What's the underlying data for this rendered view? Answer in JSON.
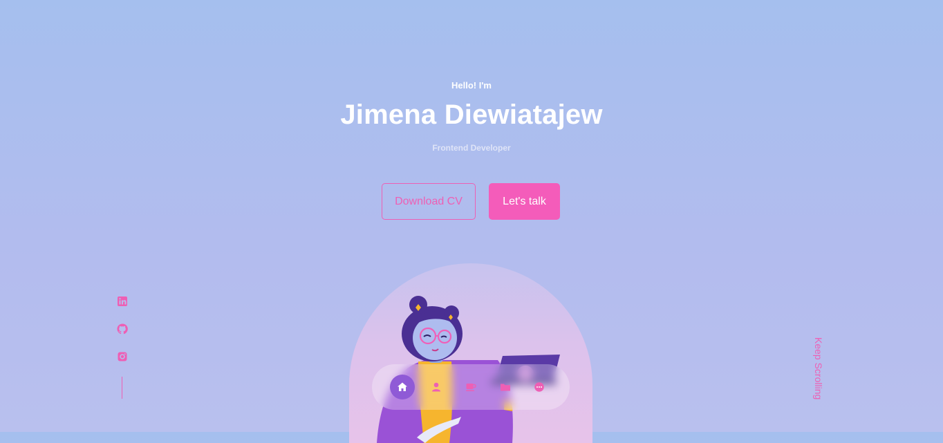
{
  "hero": {
    "greeting": "Hello! I'm",
    "name": "Jimena Diewiatajew",
    "role": "Frontend Developer",
    "download_label": "Download CV",
    "talk_label": "Let's talk"
  },
  "socials": [
    {
      "name": "linkedin-icon"
    },
    {
      "name": "github-icon"
    },
    {
      "name": "instagram-icon"
    }
  ],
  "scroll_hint": "Keep Scrolling",
  "nav": [
    {
      "name": "home-icon",
      "active": true
    },
    {
      "name": "user-icon",
      "active": false
    },
    {
      "name": "coffee-cup-icon",
      "active": false
    },
    {
      "name": "folder-icon",
      "active": false
    },
    {
      "name": "chat-bubble-icon",
      "active": false
    }
  ],
  "colors": {
    "accent": "#f45cba",
    "active_nav": "#8f5ad6",
    "text_light": "#ffffff",
    "background_top": "#a5bfee",
    "background_bottom": "#b9c0ee"
  }
}
